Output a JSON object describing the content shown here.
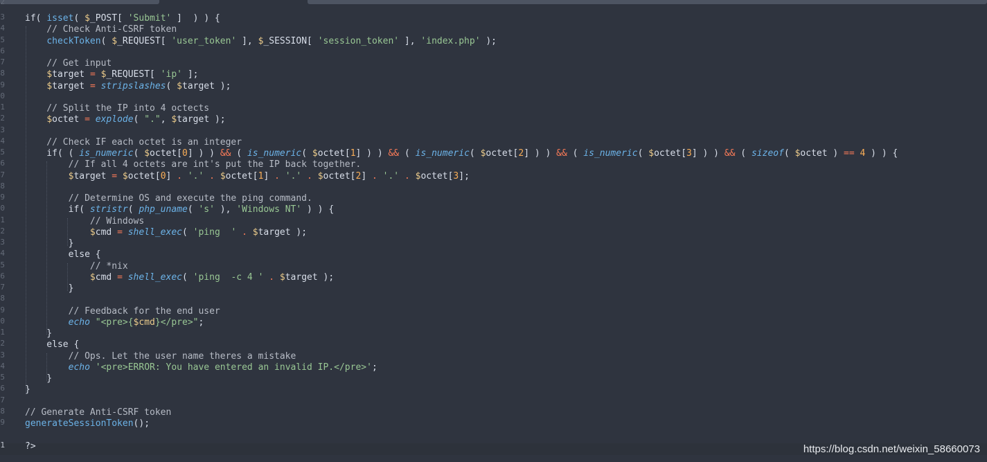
{
  "gutter": {
    "line_numbers": [
      "2",
      "3",
      "4",
      "5",
      "6",
      "7",
      "8",
      "9",
      "0",
      "1",
      "2",
      "3",
      "4",
      "5",
      "6",
      "7",
      "8",
      "9",
      "0",
      "1",
      "2",
      "3",
      "4",
      "5",
      "6",
      "7",
      "8",
      "9",
      "0",
      "1",
      "2",
      "3",
      "4",
      "5",
      "6",
      "7",
      "8",
      "9",
      "1"
    ],
    "active_line": "1"
  },
  "code": {
    "lines": [
      [],
      [
        {
          "t": "if( ",
          "c": "plain"
        },
        {
          "t": "isset",
          "c": "func"
        },
        {
          "t": "( ",
          "c": "plain"
        },
        {
          "t": "$",
          "c": "var"
        },
        {
          "t": "_POST[ ",
          "c": "plain"
        },
        {
          "t": "'Submit'",
          "c": "string"
        },
        {
          "t": " ]  ) ) {",
          "c": "plain"
        }
      ],
      [
        {
          "t": "    // Check Anti-CSRF token",
          "c": "comment"
        }
      ],
      [
        {
          "t": "    ",
          "c": "plain"
        },
        {
          "t": "checkToken",
          "c": "func"
        },
        {
          "t": "( ",
          "c": "plain"
        },
        {
          "t": "$",
          "c": "var"
        },
        {
          "t": "_REQUEST[ ",
          "c": "plain"
        },
        {
          "t": "'user_token'",
          "c": "string"
        },
        {
          "t": " ], ",
          "c": "plain"
        },
        {
          "t": "$",
          "c": "var"
        },
        {
          "t": "_SESSION[ ",
          "c": "plain"
        },
        {
          "t": "'session_token'",
          "c": "string"
        },
        {
          "t": " ], ",
          "c": "plain"
        },
        {
          "t": "'index.php'",
          "c": "string"
        },
        {
          "t": " );",
          "c": "plain"
        }
      ],
      [],
      [
        {
          "t": "    // Get input",
          "c": "comment"
        }
      ],
      [
        {
          "t": "    ",
          "c": "plain"
        },
        {
          "t": "$",
          "c": "var"
        },
        {
          "t": "target ",
          "c": "plain"
        },
        {
          "t": "=",
          "c": "op"
        },
        {
          "t": " ",
          "c": "plain"
        },
        {
          "t": "$",
          "c": "var"
        },
        {
          "t": "_REQUEST[ ",
          "c": "plain"
        },
        {
          "t": "'ip'",
          "c": "string"
        },
        {
          "t": " ];",
          "c": "plain"
        }
      ],
      [
        {
          "t": "    ",
          "c": "plain"
        },
        {
          "t": "$",
          "c": "var"
        },
        {
          "t": "target ",
          "c": "plain"
        },
        {
          "t": "=",
          "c": "op"
        },
        {
          "t": " ",
          "c": "plain"
        },
        {
          "t": "stripslashes",
          "c": "builtin"
        },
        {
          "t": "( ",
          "c": "plain"
        },
        {
          "t": "$",
          "c": "var"
        },
        {
          "t": "target );",
          "c": "plain"
        }
      ],
      [],
      [
        {
          "t": "    // Split the IP into 4 octects",
          "c": "comment"
        }
      ],
      [
        {
          "t": "    ",
          "c": "plain"
        },
        {
          "t": "$",
          "c": "var"
        },
        {
          "t": "octet ",
          "c": "plain"
        },
        {
          "t": "=",
          "c": "op"
        },
        {
          "t": " ",
          "c": "plain"
        },
        {
          "t": "explode",
          "c": "builtin"
        },
        {
          "t": "( ",
          "c": "plain"
        },
        {
          "t": "\".\"",
          "c": "string"
        },
        {
          "t": ", ",
          "c": "plain"
        },
        {
          "t": "$",
          "c": "var"
        },
        {
          "t": "target );",
          "c": "plain"
        }
      ],
      [],
      [
        {
          "t": "    // Check IF each octet is an integer",
          "c": "comment"
        }
      ],
      [
        {
          "t": "    if( ( ",
          "c": "plain"
        },
        {
          "t": "is_numeric",
          "c": "builtin"
        },
        {
          "t": "( ",
          "c": "plain"
        },
        {
          "t": "$",
          "c": "var"
        },
        {
          "t": "octet[",
          "c": "plain"
        },
        {
          "t": "0",
          "c": "num"
        },
        {
          "t": "] ) ) ",
          "c": "plain"
        },
        {
          "t": "&&",
          "c": "op"
        },
        {
          "t": " ( ",
          "c": "plain"
        },
        {
          "t": "is_numeric",
          "c": "builtin"
        },
        {
          "t": "( ",
          "c": "plain"
        },
        {
          "t": "$",
          "c": "var"
        },
        {
          "t": "octet[",
          "c": "plain"
        },
        {
          "t": "1",
          "c": "num"
        },
        {
          "t": "] ) ) ",
          "c": "plain"
        },
        {
          "t": "&&",
          "c": "op"
        },
        {
          "t": " ( ",
          "c": "plain"
        },
        {
          "t": "is_numeric",
          "c": "builtin"
        },
        {
          "t": "( ",
          "c": "plain"
        },
        {
          "t": "$",
          "c": "var"
        },
        {
          "t": "octet[",
          "c": "plain"
        },
        {
          "t": "2",
          "c": "num"
        },
        {
          "t": "] ) ) ",
          "c": "plain"
        },
        {
          "t": "&&",
          "c": "op"
        },
        {
          "t": " ( ",
          "c": "plain"
        },
        {
          "t": "is_numeric",
          "c": "builtin"
        },
        {
          "t": "( ",
          "c": "plain"
        },
        {
          "t": "$",
          "c": "var"
        },
        {
          "t": "octet[",
          "c": "plain"
        },
        {
          "t": "3",
          "c": "num"
        },
        {
          "t": "] ) ) ",
          "c": "plain"
        },
        {
          "t": "&&",
          "c": "op"
        },
        {
          "t": " ( ",
          "c": "plain"
        },
        {
          "t": "sizeof",
          "c": "builtin"
        },
        {
          "t": "( ",
          "c": "plain"
        },
        {
          "t": "$",
          "c": "var"
        },
        {
          "t": "octet ) ",
          "c": "plain"
        },
        {
          "t": "==",
          "c": "op"
        },
        {
          "t": " ",
          "c": "plain"
        },
        {
          "t": "4",
          "c": "num"
        },
        {
          "t": " ) ) {",
          "c": "plain"
        }
      ],
      [
        {
          "t": "        // If all 4 octets are int's put the IP back together.",
          "c": "comment"
        }
      ],
      [
        {
          "t": "        ",
          "c": "plain"
        },
        {
          "t": "$",
          "c": "var"
        },
        {
          "t": "target ",
          "c": "plain"
        },
        {
          "t": "=",
          "c": "op"
        },
        {
          "t": " ",
          "c": "plain"
        },
        {
          "t": "$",
          "c": "var"
        },
        {
          "t": "octet[",
          "c": "plain"
        },
        {
          "t": "0",
          "c": "num"
        },
        {
          "t": "] ",
          "c": "plain"
        },
        {
          "t": ".",
          "c": "op"
        },
        {
          "t": " ",
          "c": "plain"
        },
        {
          "t": "'.'",
          "c": "string"
        },
        {
          "t": " ",
          "c": "plain"
        },
        {
          "t": ".",
          "c": "op"
        },
        {
          "t": " ",
          "c": "plain"
        },
        {
          "t": "$",
          "c": "var"
        },
        {
          "t": "octet[",
          "c": "plain"
        },
        {
          "t": "1",
          "c": "num"
        },
        {
          "t": "] ",
          "c": "plain"
        },
        {
          "t": ".",
          "c": "op"
        },
        {
          "t": " ",
          "c": "plain"
        },
        {
          "t": "'.'",
          "c": "string"
        },
        {
          "t": " ",
          "c": "plain"
        },
        {
          "t": ".",
          "c": "op"
        },
        {
          "t": " ",
          "c": "plain"
        },
        {
          "t": "$",
          "c": "var"
        },
        {
          "t": "octet[",
          "c": "plain"
        },
        {
          "t": "2",
          "c": "num"
        },
        {
          "t": "] ",
          "c": "plain"
        },
        {
          "t": ".",
          "c": "op"
        },
        {
          "t": " ",
          "c": "plain"
        },
        {
          "t": "'.'",
          "c": "string"
        },
        {
          "t": " ",
          "c": "plain"
        },
        {
          "t": ".",
          "c": "op"
        },
        {
          "t": " ",
          "c": "plain"
        },
        {
          "t": "$",
          "c": "var"
        },
        {
          "t": "octet[",
          "c": "plain"
        },
        {
          "t": "3",
          "c": "num"
        },
        {
          "t": "];",
          "c": "plain"
        }
      ],
      [],
      [
        {
          "t": "        // Determine OS and execute the ping command.",
          "c": "comment"
        }
      ],
      [
        {
          "t": "        if( ",
          "c": "plain"
        },
        {
          "t": "stristr",
          "c": "builtin"
        },
        {
          "t": "( ",
          "c": "plain"
        },
        {
          "t": "php_uname",
          "c": "builtin"
        },
        {
          "t": "( ",
          "c": "plain"
        },
        {
          "t": "'s'",
          "c": "string"
        },
        {
          "t": " ), ",
          "c": "plain"
        },
        {
          "t": "'Windows NT'",
          "c": "string"
        },
        {
          "t": " ) ) {",
          "c": "plain"
        }
      ],
      [
        {
          "t": "            // Windows",
          "c": "comment"
        }
      ],
      [
        {
          "t": "            ",
          "c": "plain"
        },
        {
          "t": "$",
          "c": "var"
        },
        {
          "t": "cmd ",
          "c": "plain"
        },
        {
          "t": "=",
          "c": "op"
        },
        {
          "t": " ",
          "c": "plain"
        },
        {
          "t": "shell_exec",
          "c": "builtin"
        },
        {
          "t": "( ",
          "c": "plain"
        },
        {
          "t": "'ping  '",
          "c": "string"
        },
        {
          "t": " ",
          "c": "plain"
        },
        {
          "t": ".",
          "c": "op"
        },
        {
          "t": " ",
          "c": "plain"
        },
        {
          "t": "$",
          "c": "var"
        },
        {
          "t": "target );",
          "c": "plain"
        }
      ],
      [
        {
          "t": "        }",
          "c": "plain"
        }
      ],
      [
        {
          "t": "        else {",
          "c": "plain"
        }
      ],
      [
        {
          "t": "            // *nix",
          "c": "comment"
        }
      ],
      [
        {
          "t": "            ",
          "c": "plain"
        },
        {
          "t": "$",
          "c": "var"
        },
        {
          "t": "cmd ",
          "c": "plain"
        },
        {
          "t": "=",
          "c": "op"
        },
        {
          "t": " ",
          "c": "plain"
        },
        {
          "t": "shell_exec",
          "c": "builtin"
        },
        {
          "t": "( ",
          "c": "plain"
        },
        {
          "t": "'ping  -c 4 '",
          "c": "string"
        },
        {
          "t": " ",
          "c": "plain"
        },
        {
          "t": ".",
          "c": "op"
        },
        {
          "t": " ",
          "c": "plain"
        },
        {
          "t": "$",
          "c": "var"
        },
        {
          "t": "target );",
          "c": "plain"
        }
      ],
      [
        {
          "t": "        }",
          "c": "plain"
        }
      ],
      [],
      [
        {
          "t": "        // Feedback for the end user",
          "c": "comment"
        }
      ],
      [
        {
          "t": "        ",
          "c": "plain"
        },
        {
          "t": "echo",
          "c": "builtin"
        },
        {
          "t": " ",
          "c": "plain"
        },
        {
          "t": "\"<pre>{",
          "c": "string"
        },
        {
          "t": "$cmd",
          "c": "var"
        },
        {
          "t": "}</pre>\"",
          "c": "string"
        },
        {
          "t": ";",
          "c": "plain"
        }
      ],
      [
        {
          "t": "    }",
          "c": "plain"
        }
      ],
      [
        {
          "t": "    else {",
          "c": "plain"
        }
      ],
      [
        {
          "t": "        // Ops. Let the user name theres a mistake",
          "c": "comment"
        }
      ],
      [
        {
          "t": "        ",
          "c": "plain"
        },
        {
          "t": "echo",
          "c": "builtin"
        },
        {
          "t": " ",
          "c": "plain"
        },
        {
          "t": "'<pre>ERROR: You have entered an invalid IP.</pre>'",
          "c": "string"
        },
        {
          "t": ";",
          "c": "plain"
        }
      ],
      [
        {
          "t": "    }",
          "c": "plain"
        }
      ],
      [
        {
          "t": "}",
          "c": "plain"
        }
      ],
      [],
      [
        {
          "t": "// Generate Anti-CSRF token",
          "c": "comment"
        }
      ],
      [
        {
          "t": "generateSessionToken",
          "c": "func"
        },
        {
          "t": "();",
          "c": "plain"
        }
      ],
      [
        {
          "t": "?>",
          "c": "plain"
        }
      ]
    ]
  },
  "watermark": {
    "text": "https://blog.csdn.net/weixin_58660073"
  },
  "colors": {
    "background": "#2f343f",
    "comment": "#b7bcc6",
    "string": "#99c794",
    "function": "#6cb3e8",
    "variable_sigil": "#ebcb8b",
    "operator": "#f97b58",
    "number": "#f9ae58"
  }
}
